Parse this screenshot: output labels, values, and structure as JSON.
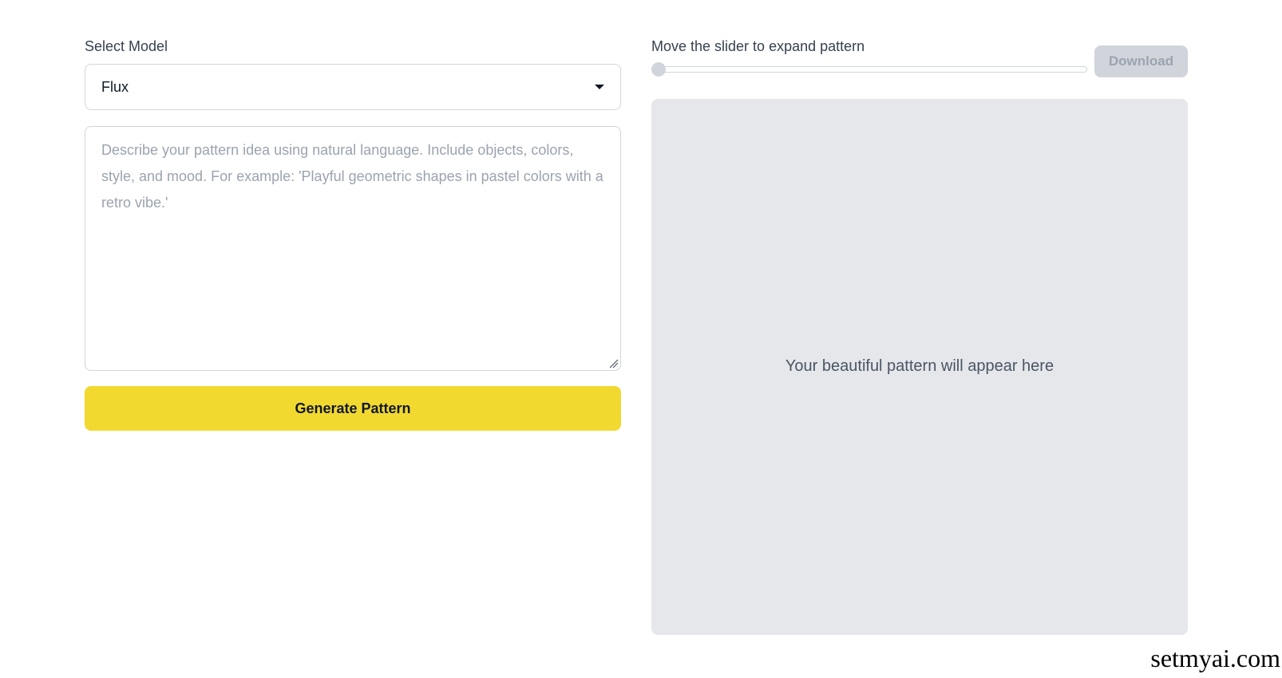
{
  "model_select": {
    "label": "Select Model",
    "value": "Flux"
  },
  "prompt": {
    "placeholder": "Describe your pattern idea using natural language. Include objects, colors, style, and mood. For example: 'Playful geometric shapes in pastel colors with a retro vibe.'",
    "value": ""
  },
  "generate_button": {
    "label": "Generate Pattern",
    "color": "#f2d930"
  },
  "slider": {
    "label": "Move the slider to expand pattern",
    "value_fraction": 0
  },
  "download_button": {
    "label": "Download",
    "disabled": true
  },
  "preview": {
    "placeholder": "Your beautiful pattern will appear here"
  },
  "watermark": {
    "text": "setmyai.com"
  },
  "icons": {
    "select_caret": "chevron-down-icon",
    "resize": "resize-handle-icon"
  }
}
